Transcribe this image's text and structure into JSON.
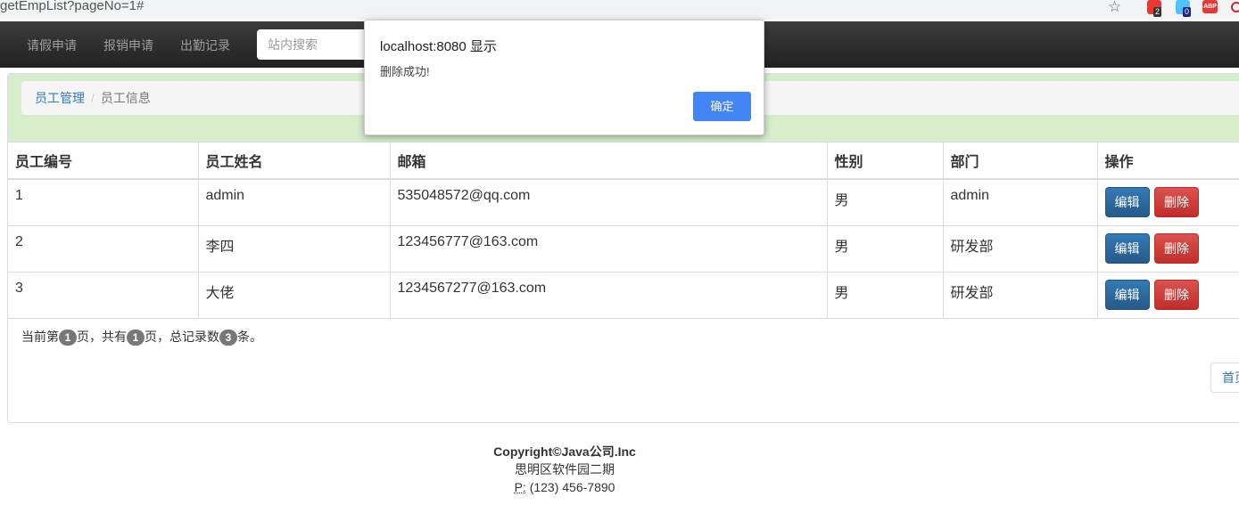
{
  "browser": {
    "url": "getEmpList?pageNo=1#",
    "extension_badges": [
      "2",
      "0"
    ],
    "abp_label": "ABP"
  },
  "nav": {
    "items": [
      "请假申请",
      "报销申请",
      "出勤记录"
    ],
    "search_placeholder": "站内搜索"
  },
  "breadcrumb": {
    "parent": "员工管理",
    "current": "员工信息"
  },
  "table": {
    "headers": [
      "员工编号",
      "员工姓名",
      "邮箱",
      "性别",
      "部门",
      "操作"
    ],
    "rows": [
      {
        "id": "1",
        "name": "admin",
        "email": "535048572@qq.com",
        "gender": "男",
        "dept": "admin"
      },
      {
        "id": "2",
        "name": "李四",
        "email": "123456777@163.com",
        "gender": "男",
        "dept": "研发部"
      },
      {
        "id": "3",
        "name": "大佬",
        "email": "1234567277@163.com",
        "gender": "男",
        "dept": "研发部"
      }
    ],
    "edit_label": "编辑",
    "delete_label": "删除"
  },
  "pagination": {
    "text1": "当前第",
    "current_page": "1",
    "text2": "页，共有",
    "total_pages": "1",
    "text3": "页，总记录数",
    "total_records": "3",
    "text4": "条。",
    "first_label": "首页"
  },
  "footer": {
    "copyright": "Copyright©Java公司.Inc",
    "address": "思明区软件园二期",
    "phone_label": "P:",
    "phone": "(123) 456-7890"
  },
  "dialog": {
    "title": "localhost:8080 显示",
    "message": "删除成功!",
    "ok_label": "确定"
  },
  "colors": {
    "navbar": "#222222",
    "panel_heading": "#d6eecb",
    "edit_button": "#337ab7",
    "delete_button": "#d9534f",
    "dialog_ok": "#4285f4"
  }
}
